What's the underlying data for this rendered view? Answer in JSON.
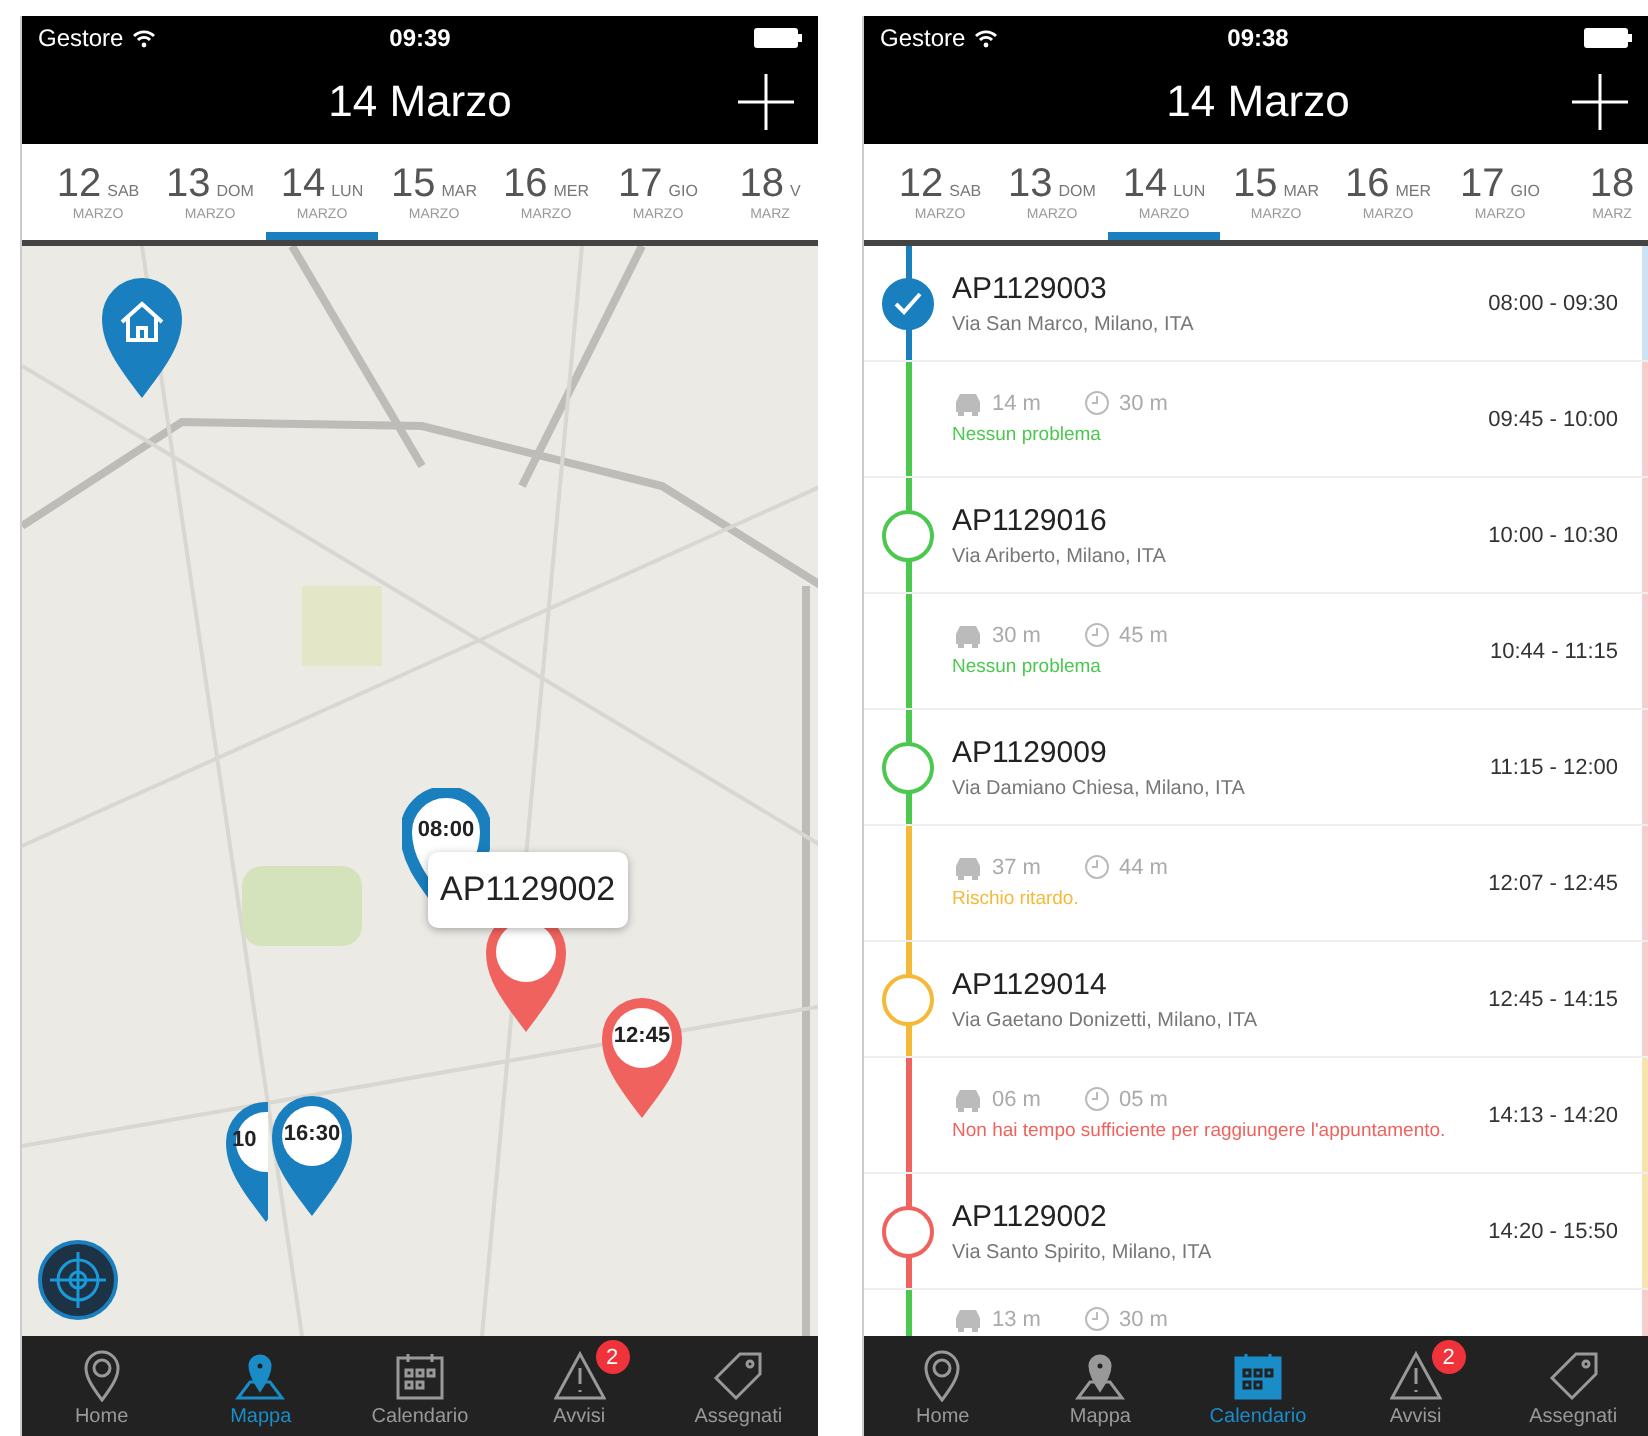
{
  "screens": [
    {
      "kind": "map",
      "status_bar": {
        "carrier": "Gestore",
        "time": "09:39"
      },
      "title": "14 Marzo",
      "dates": [
        {
          "day": "12",
          "weekday": "SAB",
          "month": "MARZO",
          "selected": false
        },
        {
          "day": "13",
          "weekday": "DOM",
          "month": "MARZO",
          "selected": false
        },
        {
          "day": "14",
          "weekday": "LUN",
          "month": "MARZO",
          "selected": true
        },
        {
          "day": "15",
          "weekday": "MAR",
          "month": "MARZO",
          "selected": false
        },
        {
          "day": "16",
          "weekday": "MER",
          "month": "MARZO",
          "selected": false
        },
        {
          "day": "17",
          "weekday": "GIO",
          "month": "MARZO",
          "selected": false
        },
        {
          "day": "18",
          "weekday": "V",
          "month": "MARZ",
          "selected": false
        }
      ],
      "map": {
        "pins": [
          {
            "kind": "home",
            "color": "#1a7fbf"
          },
          {
            "kind": "outline",
            "label": "08:00",
            "color": "#1a7fbf"
          },
          {
            "kind": "plain",
            "color": "#f0625e"
          },
          {
            "kind": "time",
            "label": "12:45",
            "color": "#f0625e"
          },
          {
            "kind": "time",
            "label": "10",
            "color": "#1a7fbf"
          },
          {
            "kind": "time",
            "label": "16:30",
            "color": "#1a7fbf"
          }
        ],
        "callout": "AP1129002"
      },
      "tabs": [
        {
          "label": "Home",
          "selected": false
        },
        {
          "label": "Mappa",
          "selected": true
        },
        {
          "label": "Calendario",
          "selected": false
        },
        {
          "label": "Avvisi",
          "selected": false,
          "badge": "2"
        },
        {
          "label": "Assegnati",
          "selected": false
        }
      ]
    },
    {
      "kind": "list",
      "status_bar": {
        "carrier": "Gestore",
        "time": "09:38"
      },
      "title": "14 Marzo",
      "dates": [
        {
          "day": "12",
          "weekday": "SAB",
          "month": "MARZO",
          "selected": false
        },
        {
          "day": "13",
          "weekday": "DOM",
          "month": "MARZO",
          "selected": false
        },
        {
          "day": "14",
          "weekday": "LUN",
          "month": "MARZO",
          "selected": true
        },
        {
          "day": "15",
          "weekday": "MAR",
          "month": "MARZO",
          "selected": false
        },
        {
          "day": "16",
          "weekday": "MER",
          "month": "MARZO",
          "selected": false
        },
        {
          "day": "17",
          "weekday": "GIO",
          "month": "MARZO",
          "selected": false
        },
        {
          "day": "18",
          "month": "MARZ",
          "selected": false
        }
      ],
      "rows": [
        {
          "kind": "appointment",
          "code": "AP1129003",
          "address": "Via San Marco, Milano, ITA",
          "time": "08:00 - 09:30",
          "checked": true,
          "color": "#1a7fbf",
          "stripe": {
            "color": "#cfe2f3"
          }
        },
        {
          "kind": "travel",
          "drive": "14 m",
          "wait": "30 m",
          "note": "Nessun problema",
          "time": "09:45 - 10:00",
          "color": "#4cc850",
          "stripe": {
            "color": "#f6cccc"
          }
        },
        {
          "kind": "appointment",
          "code": "AP1129016",
          "address": "Via Ariberto, Milano, ITA",
          "time": "10:00 - 10:30",
          "checked": false,
          "color": "#4cc850",
          "stripe": {
            "color": "#f6cccc"
          }
        },
        {
          "kind": "travel",
          "drive": "30 m",
          "wait": "45 m",
          "note": "Nessun problema",
          "time": "10:44 - 11:15",
          "color": "#4cc850",
          "stripe": {
            "color": "#f6cccc"
          }
        },
        {
          "kind": "appointment",
          "code": "AP1129009",
          "address": "Via Damiano Chiesa, Milano, ITA",
          "time": "11:15 - 12:00",
          "checked": false,
          "color": "#4cc850",
          "stripe": {
            "color": "#f6cccc"
          }
        },
        {
          "kind": "travel",
          "drive": "37 m",
          "wait": "44 m",
          "note": "Rischio ritardo.",
          "time": "12:07 - 12:45",
          "color": "#f5b939",
          "stripe": {
            "color": "#f6cccc"
          }
        },
        {
          "kind": "appointment",
          "code": "AP1129014",
          "address": "Via Gaetano Donizetti, Milano, ITA",
          "time": "12:45 - 14:15",
          "checked": false,
          "color": "#f5b939",
          "stripe": {
            "color": "#f6cccc"
          }
        },
        {
          "kind": "travel",
          "drive": "06 m",
          "wait": "05 m",
          "note": "Non hai tempo sufficiente per raggiungere l'appuntamento.",
          "time": "14:13 - 14:20",
          "color": "#f0625e",
          "stripe": {
            "color": "#f7e3b0"
          }
        },
        {
          "kind": "appointment",
          "code": "AP1129002",
          "address": "Via Santo Spirito, Milano, ITA",
          "time": "14:20 - 15:50",
          "checked": false,
          "color": "#f0625e",
          "stripe": {
            "color": "#f7e3b0"
          }
        },
        {
          "kind": "travel",
          "drive": "13 m",
          "wait": "30 m",
          "color": "#4cc850",
          "stripe": {
            "color": "#f6cccc"
          }
        }
      ],
      "tabs": [
        {
          "label": "Home",
          "selected": false
        },
        {
          "label": "Mappa",
          "selected": false
        },
        {
          "label": "Calendario",
          "selected": true
        },
        {
          "label": "Avvisi",
          "selected": false,
          "badge": "2"
        },
        {
          "label": "Assegnati",
          "selected": false
        }
      ]
    }
  ]
}
